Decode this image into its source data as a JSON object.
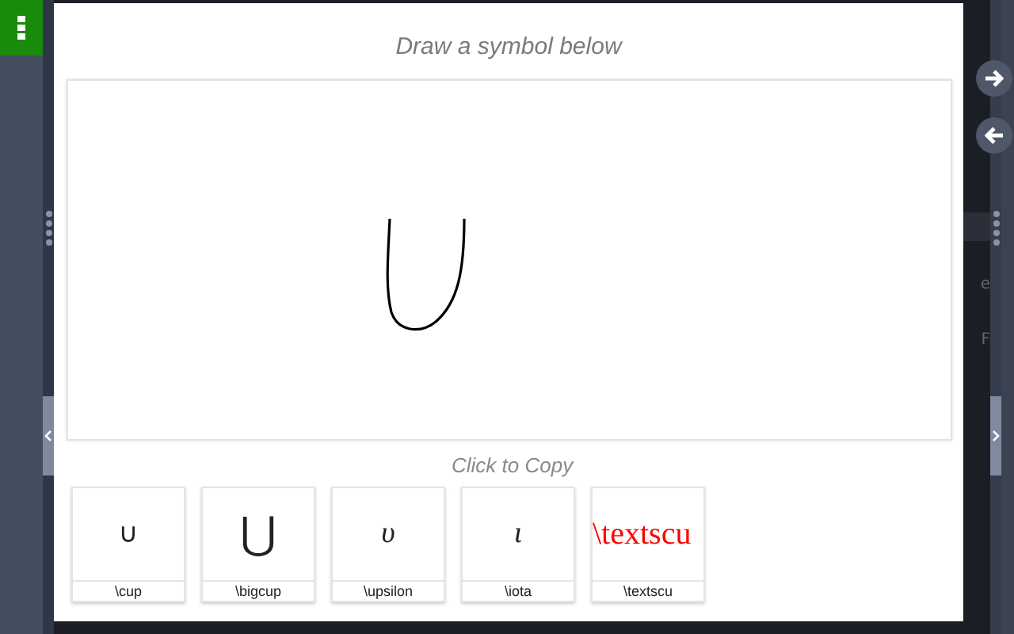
{
  "dialog": {
    "title": "Draw a symbol below",
    "hint": "Click to Copy"
  },
  "candidates": [
    {
      "symbol": "∪",
      "kind": "math",
      "command": "\\cup"
    },
    {
      "symbol": "⋃",
      "kind": "big",
      "command": "\\bigcup"
    },
    {
      "symbol": "υ",
      "kind": "italic",
      "command": "\\upsilon"
    },
    {
      "symbol": "ι",
      "kind": "italic",
      "command": "\\iota"
    },
    {
      "symbol": "\\textscu",
      "kind": "error",
      "command": "\\textscu"
    }
  ],
  "background_text": [
    "e",
    "F"
  ]
}
